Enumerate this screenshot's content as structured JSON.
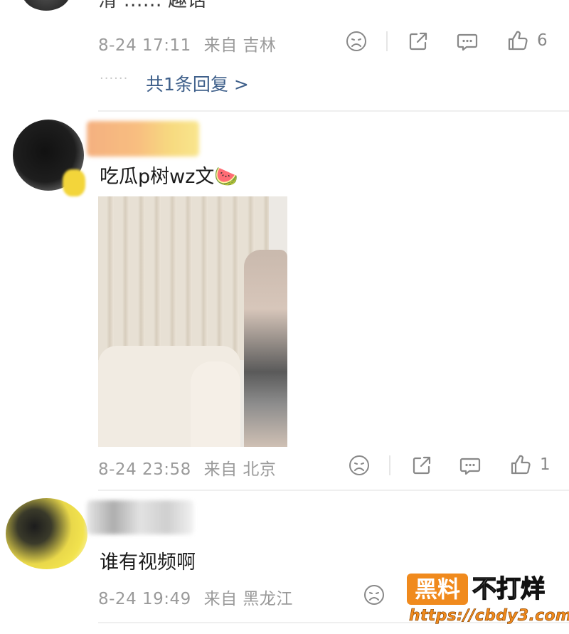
{
  "comments": [
    {
      "timestamp": "8-24 17:11",
      "location": "来自 吉林",
      "like_count": "6",
      "replies_label": "共1条回复 >",
      "replies_dots": "······",
      "partial_text": "滑 …… 趣话"
    },
    {
      "text": "吃瓜p树wz文🍉",
      "timestamp": "8-24 23:58",
      "location": "来自 北京",
      "like_count": "1"
    },
    {
      "text": "谁有视频啊",
      "timestamp": "8-24 19:49",
      "location": "来自 黑龙江"
    }
  ],
  "watermark": {
    "badge": "黑料",
    "title": "不打烊",
    "url": "https://cbdy3.com"
  },
  "colors": {
    "link": "#3e5f8a",
    "meta": "#9a9a9a",
    "watermark_orange": "#f08a1d"
  }
}
